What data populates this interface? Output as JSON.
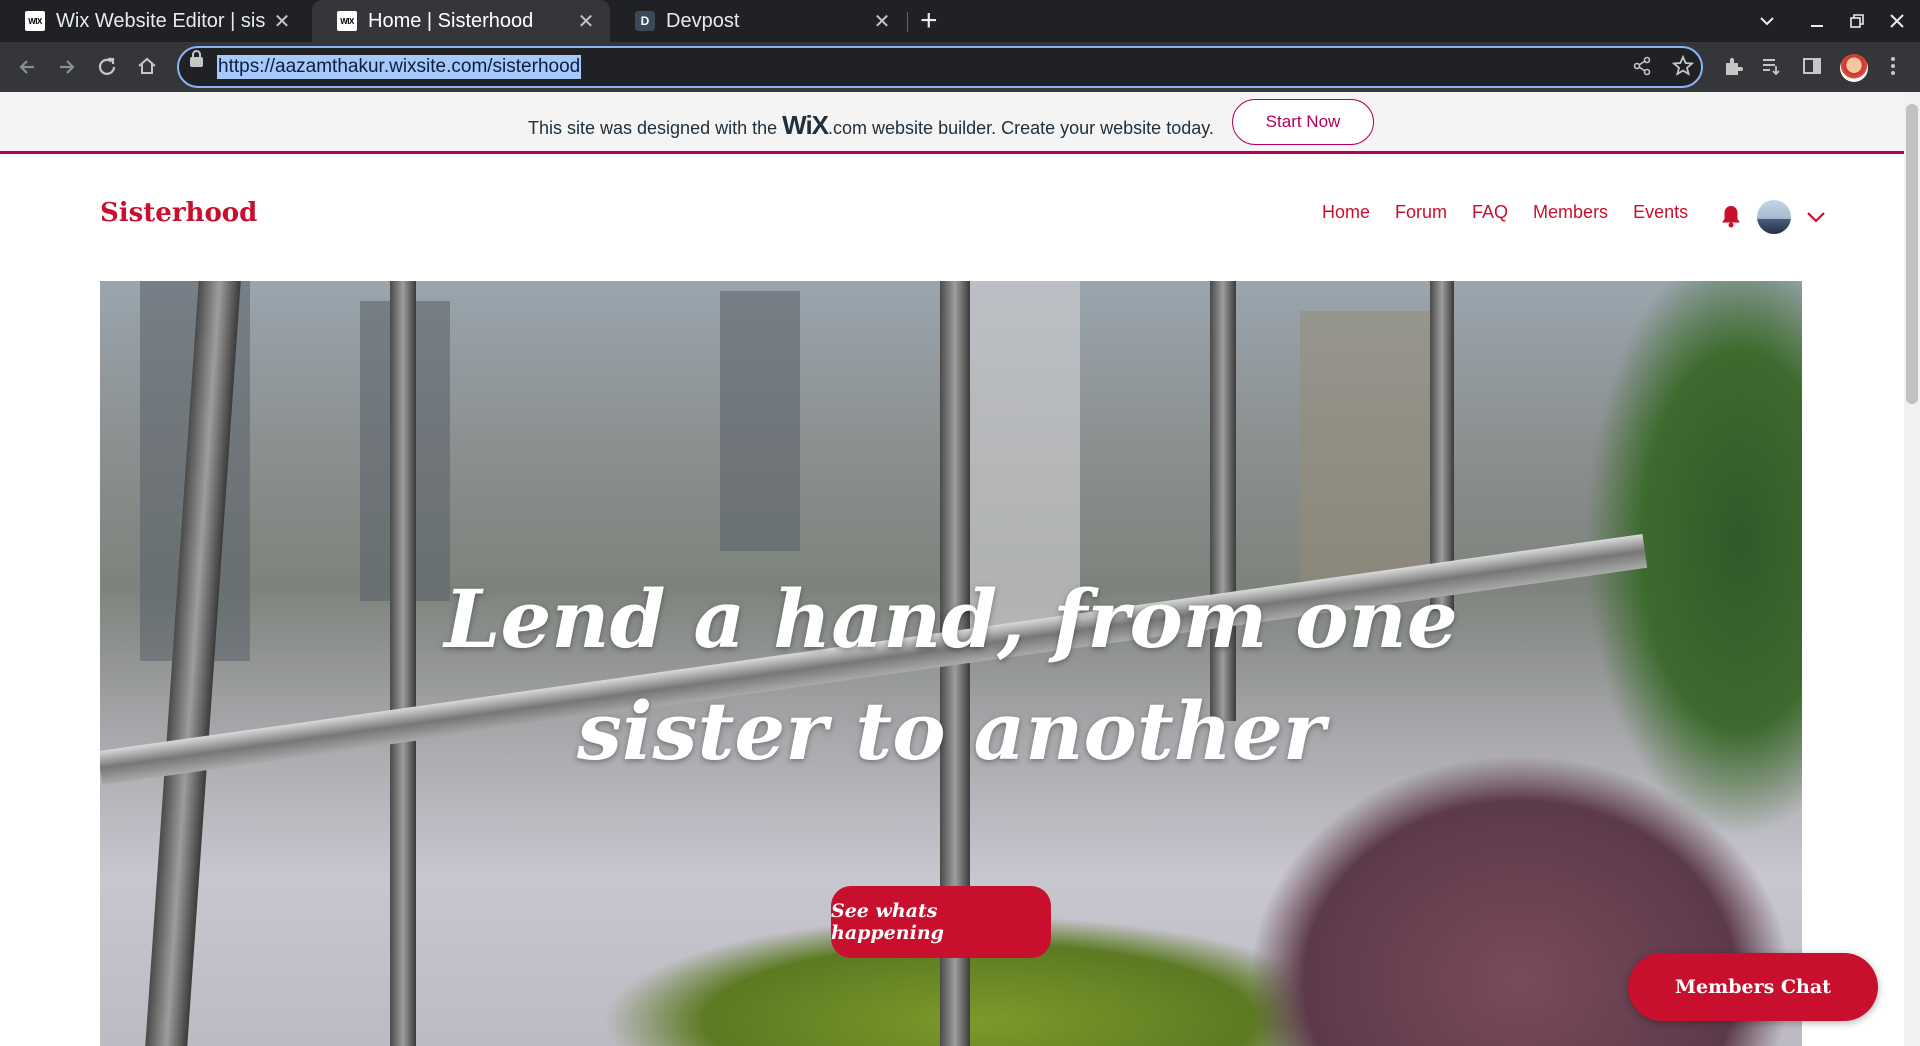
{
  "browser": {
    "tabs": [
      {
        "title": "Wix Website Editor | sis",
        "favicon": "wix-icon",
        "active": false
      },
      {
        "title": "Home | Sisterhood",
        "favicon": "wix-icon",
        "active": true
      },
      {
        "title": "Devpost",
        "favicon": "devpost-icon",
        "active": false
      }
    ],
    "url": "https://aazamthakur.wixsite.com/sisterhood",
    "new_tab_glyph": "+",
    "close_glyph": "✕"
  },
  "wix_banner": {
    "text_before": "This site was designed with the ",
    "logo": "WiX",
    "text_after": ".com website builder. Create your website today.",
    "cta": "Start Now",
    "accent_color": "#b4005a"
  },
  "site": {
    "logo": "Sisterhood",
    "brand_color": "#c8102e",
    "menu": [
      "Home",
      "Forum",
      "FAQ",
      "Members",
      "Events"
    ],
    "hero": {
      "title_line1": "Lend a hand, from one",
      "title_line2": "sister to another",
      "cta": "See whats happening"
    },
    "chat_button": "Members Chat"
  }
}
